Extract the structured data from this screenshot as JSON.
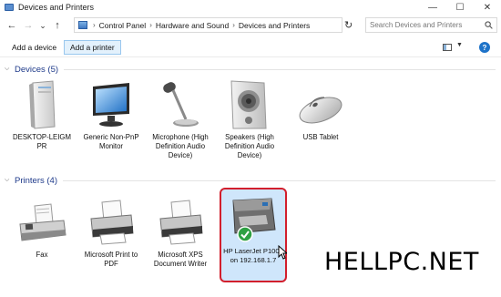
{
  "window": {
    "title": "Devices and Printers",
    "minimize": "—",
    "maximize": "☐",
    "close": "✕"
  },
  "nav": {
    "back": "←",
    "forward": "→",
    "down": "⌄",
    "up": "↑",
    "refresh": "↻"
  },
  "address": {
    "crumbs": [
      "Control Panel",
      "Hardware and Sound",
      "Devices and Printers"
    ],
    "separator": "›"
  },
  "search": {
    "placeholder": "Search Devices and Printers"
  },
  "toolbar": {
    "add_device": "Add a device",
    "add_printer": "Add a printer",
    "help": "?"
  },
  "sections": {
    "devices": {
      "label": "Devices (5)",
      "caret": "⌵"
    },
    "printers": {
      "label": "Printers (4)",
      "caret": "⌵"
    }
  },
  "devices": [
    {
      "label": "DESKTOP-LEIGM PR",
      "icon": "computer-tower-icon"
    },
    {
      "label": "Generic Non-PnP Monitor",
      "icon": "monitor-icon"
    },
    {
      "label": "Microphone (High Definition Audio Device)",
      "icon": "microphone-icon"
    },
    {
      "label": "Speakers (High Definition Audio Device)",
      "icon": "speaker-icon"
    },
    {
      "label": "USB Tablet",
      "icon": "mouse-icon"
    }
  ],
  "printers": [
    {
      "label": "Fax",
      "icon": "fax-icon"
    },
    {
      "label": "Microsoft Print to PDF",
      "icon": "printer-icon"
    },
    {
      "label": "Microsoft XPS Document Writer",
      "icon": "printer-icon"
    },
    {
      "label": "HP LaserJet P1008 on 192.168.1.7",
      "icon": "laser-printer-icon",
      "default": true
    }
  ],
  "watermark": "HELLPC.NET",
  "colors": {
    "accent": "#1e73c9",
    "selection": "#cfe6fb",
    "highlight_border": "#d21f2d",
    "section_label": "#1e3a8a",
    "default_check": "#2ea043"
  }
}
